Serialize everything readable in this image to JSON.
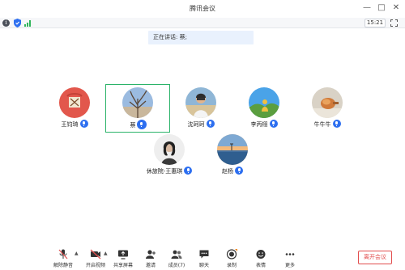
{
  "window": {
    "title": "腾讯会议"
  },
  "status": {
    "time": "15:21"
  },
  "speaking_banner": "正在讲话: 蔡;",
  "participants": [
    {
      "name": "王钧琦"
    },
    {
      "name": "蔡",
      "active": true
    },
    {
      "name": "沈珂珂"
    },
    {
      "name": "李丙栩"
    },
    {
      "name": "牛牛牛"
    },
    {
      "name": "休旅院-王惠琪"
    },
    {
      "name": "赵杨"
    }
  ],
  "toolbar": {
    "mute": "解除静音",
    "video": "开启视频",
    "share": "共享屏幕",
    "invite": "邀请",
    "members": "成员(7)",
    "chat": "聊天",
    "record": "录制",
    "reaction": "表情",
    "more": "更多",
    "leave": "离开会议"
  },
  "colors": {
    "active_border": "#2bb369",
    "accent": "#2d6ff0",
    "leave": "#e24d4d"
  }
}
